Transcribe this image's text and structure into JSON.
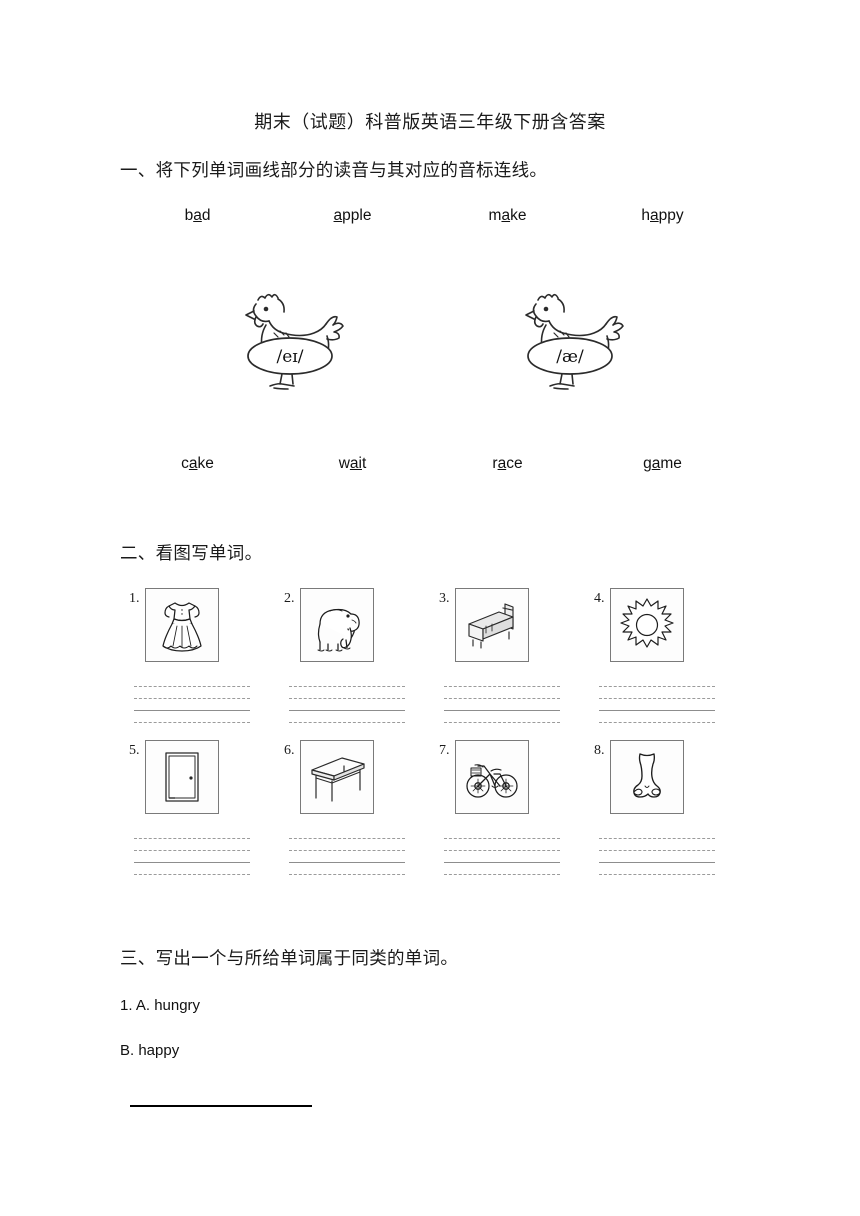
{
  "document": {
    "title": "期末（试题）科普版英语三年级下册含答案"
  },
  "sections": [
    {
      "id": "section-1",
      "heading": "一、将下列单词画线部分的读音与其对应的音标连线。",
      "words_top": [
        {
          "pre": "b",
          "mark": "a",
          "post": "d",
          "full": "bad"
        },
        {
          "pre": "",
          "mark": "a",
          "post": "pple",
          "full": "apple"
        },
        {
          "pre": "m",
          "mark": "a",
          "post": "ke",
          "full": "make"
        },
        {
          "pre": "h",
          "mark": "a",
          "post": "ppy",
          "full": "happy"
        }
      ],
      "phonetics": [
        {
          "symbol": "/eɪ/",
          "icon": "hen-icon"
        },
        {
          "symbol": "/æ/",
          "icon": "hen-icon"
        }
      ],
      "words_bottom": [
        {
          "pre": "c",
          "mark": "a",
          "post": "ke",
          "full": "cake"
        },
        {
          "pre": "w",
          "mark": "ai",
          "post": "t",
          "full": "wait"
        },
        {
          "pre": "r",
          "mark": "a",
          "post": "ce",
          "full": "race"
        },
        {
          "pre": "g",
          "mark": "a",
          "post": "me",
          "full": "game"
        }
      ]
    },
    {
      "id": "section-2",
      "heading": "二、看图写单词。",
      "pictures": [
        {
          "number": "1.",
          "icon": "dress-icon"
        },
        {
          "number": "2.",
          "icon": "elephant-icon"
        },
        {
          "number": "3.",
          "icon": "bed-icon"
        },
        {
          "number": "4.",
          "icon": "sun-icon"
        },
        {
          "number": "5.",
          "icon": "door-icon"
        },
        {
          "number": "6.",
          "icon": "table-icon"
        },
        {
          "number": "7.",
          "icon": "bicycle-icon"
        },
        {
          "number": "8.",
          "icon": "nose-icon"
        }
      ]
    },
    {
      "id": "section-3",
      "heading": "三、写出一个与所给单词属于同类的单词。",
      "questions": [
        {
          "option_a": "1. A. hungry",
          "option_b": "B. happy"
        }
      ]
    }
  ],
  "colors": {
    "text": "#111111",
    "rule": "#000000",
    "guide_line": "#9b9b9b",
    "box_border": "#7a7a7a"
  }
}
